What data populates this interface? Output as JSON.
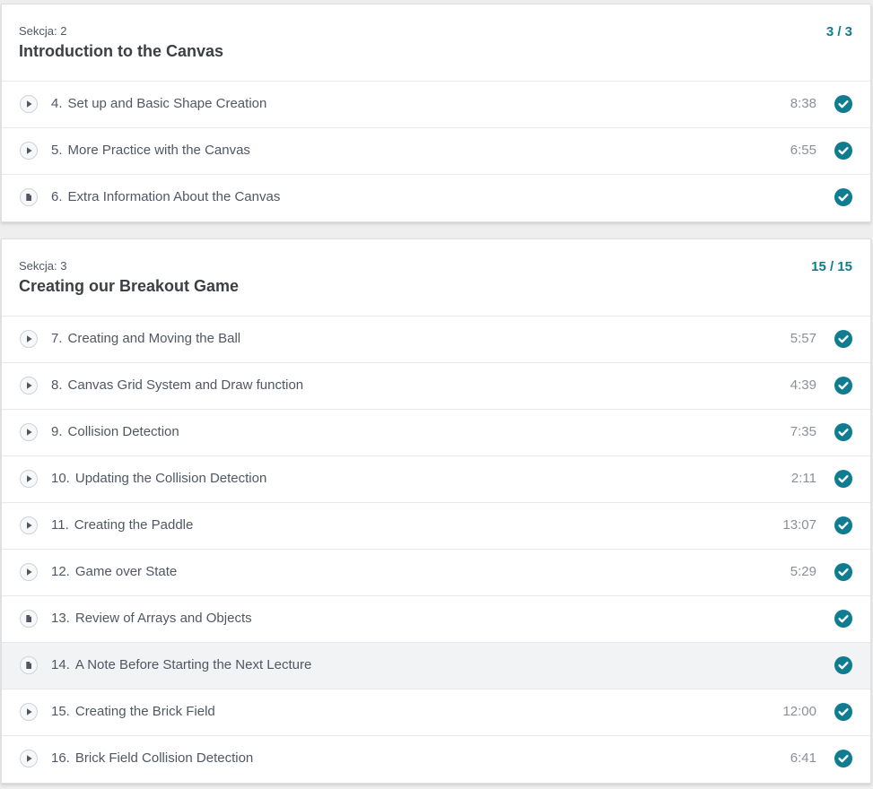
{
  "accent_color": "#0f7c90",
  "sections": [
    {
      "label": "Sekcja: 2",
      "title": "Introduction to the Canvas",
      "progress": "3 / 3",
      "lectures": [
        {
          "num": "4.",
          "title": "Set up and Basic Shape Creation",
          "duration": "8:38",
          "type": "play-icon",
          "completed": true
        },
        {
          "num": "5.",
          "title": "More Practice with the Canvas",
          "duration": "6:55",
          "type": "play-icon",
          "completed": true
        },
        {
          "num": "6.",
          "title": "Extra Information About the Canvas",
          "duration": "",
          "type": "document-icon",
          "completed": true
        }
      ]
    },
    {
      "label": "Sekcja: 3",
      "title": "Creating our Breakout Game",
      "progress": "15 / 15",
      "lectures": [
        {
          "num": "7.",
          "title": "Creating and Moving the Ball",
          "duration": "5:57",
          "type": "play-icon",
          "completed": true
        },
        {
          "num": "8.",
          "title": "Canvas Grid System and Draw function",
          "duration": "4:39",
          "type": "play-icon",
          "completed": true
        },
        {
          "num": "9.",
          "title": "Collision Detection",
          "duration": "7:35",
          "type": "play-icon",
          "completed": true
        },
        {
          "num": "10.",
          "title": "Updating the Collision Detection",
          "duration": "2:11",
          "type": "play-icon",
          "completed": true
        },
        {
          "num": "11.",
          "title": "Creating the Paddle",
          "duration": "13:07",
          "type": "play-icon",
          "completed": true
        },
        {
          "num": "12.",
          "title": "Game over State",
          "duration": "5:29",
          "type": "play-icon",
          "completed": true
        },
        {
          "num": "13.",
          "title": "Review of Arrays and Objects",
          "duration": "",
          "type": "document-icon",
          "completed": true
        },
        {
          "num": "14.",
          "title": "A Note Before Starting the Next Lecture",
          "duration": "",
          "type": "document-icon",
          "completed": true,
          "highlighted": true
        },
        {
          "num": "15.",
          "title": "Creating the Brick Field",
          "duration": "12:00",
          "type": "play-icon",
          "completed": true
        },
        {
          "num": "16.",
          "title": "Brick Field Collision Detection",
          "duration": "6:41",
          "type": "play-icon",
          "completed": true
        }
      ]
    }
  ]
}
